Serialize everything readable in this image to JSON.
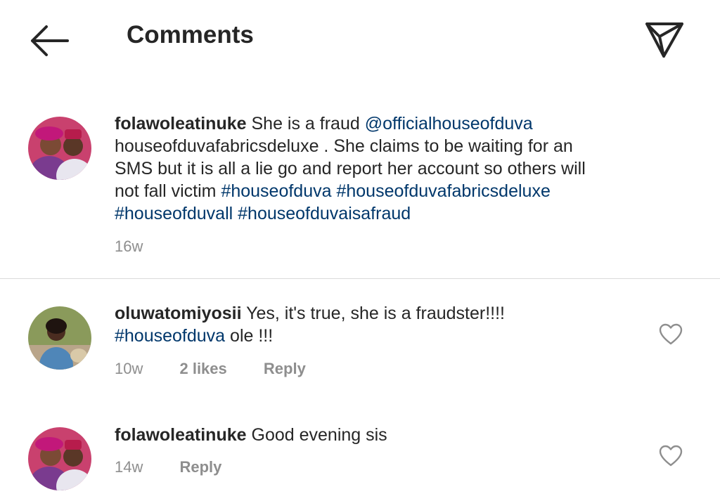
{
  "header": {
    "title": "Comments",
    "back_icon": "arrow-left-icon",
    "send_icon": "paper-plane-icon"
  },
  "caption": {
    "username": "folawoleatinuke",
    "text_1": "She is a fraud",
    "mention": "@officialhouseofduva",
    "text_2": "houseofduvafabricsdeluxe . She claims to  be waiting for an",
    "text_3": "SMS but it is all a lie go and report her account so others will",
    "text_4": "not fall victim",
    "hashtags_line1": "#houseofduva #houseofduvafabricsdeluxe",
    "hashtags_line2": "#houseofduvall #houseofduvaisafraud",
    "time": "16w"
  },
  "comments": [
    {
      "username": "oluwatomiyosii",
      "text": "Yes, it's true, she is a fraudster!!!!",
      "hashtag": "#houseofduva",
      "text_after": " ole !!!",
      "time": "10w",
      "likes": "2 likes",
      "reply": "Reply"
    },
    {
      "username": "folawoleatinuke",
      "text": "Good evening sis",
      "time": "14w",
      "reply": "Reply"
    }
  ],
  "colors": {
    "hashtag": "#00376b",
    "meta": "#8e8e8e",
    "divider": "#dbdbdb"
  }
}
